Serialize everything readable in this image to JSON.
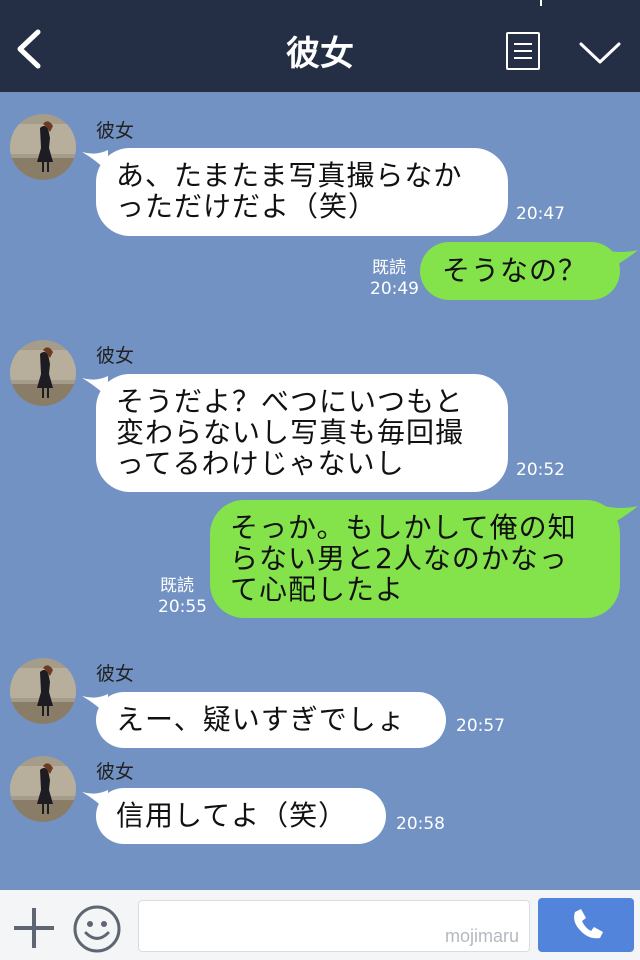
{
  "header": {
    "title": "彼女"
  },
  "messages": [
    {
      "side": "left",
      "sender": "彼女",
      "text": "あ、たまたま写真撮らなか\nっただけだよ（笑）",
      "time": "20:47"
    },
    {
      "side": "right",
      "text": "そうなの？",
      "read": "既読",
      "time": "20:49"
    },
    {
      "side": "left",
      "sender": "彼女",
      "text": "そうだよ？べつにいつもと\n変わらないし写真も毎回撮\nってるわけじゃないし",
      "time": "20:52"
    },
    {
      "side": "right",
      "text": "そっか。もしかして俺の知\nらない男と2人なのかなっ\nて心配したよ",
      "read": "既読",
      "time": "20:55"
    },
    {
      "side": "left",
      "sender": "彼女",
      "text": "えー、疑いすぎでしょ",
      "time": "20:57"
    },
    {
      "side": "left",
      "sender": "彼女",
      "text": "信用してよ（笑）",
      "time": "20:58"
    }
  ],
  "input": {
    "watermark": "mojimaru"
  },
  "icons": {
    "back": "chevron-left-icon",
    "menu": "list-icon",
    "collapse": "chevron-down-icon",
    "add": "plus-icon",
    "emoji": "smiley-icon",
    "call": "phone-icon"
  },
  "colors": {
    "header": "#242f46",
    "background": "#7192c3",
    "sent": "#84e24b",
    "received": "#ffffff",
    "send_button": "#5384dc"
  }
}
